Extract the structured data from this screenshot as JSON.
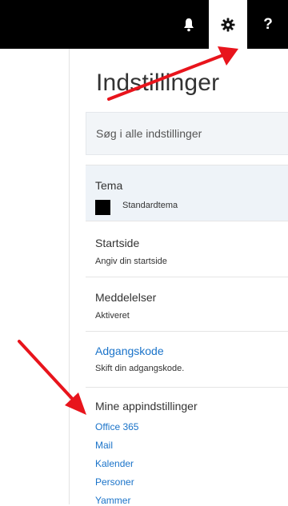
{
  "header": {
    "icons": [
      {
        "name": "bell-icon",
        "glyph": "🔔"
      },
      {
        "name": "gear-icon",
        "glyph": "⚙"
      },
      {
        "name": "help-icon",
        "glyph": "?"
      }
    ],
    "accent_color": "#000000"
  },
  "settings": {
    "title": "Indstillinger",
    "search_placeholder": "Søg i alle indstillinger"
  },
  "sections": {
    "theme": {
      "title": "Tema",
      "value": "Standardtema"
    },
    "startpage": {
      "title": "Startside",
      "subtitle": "Angiv din startside"
    },
    "notifications": {
      "title": "Meddelelser",
      "subtitle": "Aktiveret"
    },
    "password": {
      "title": "Adgangskode",
      "subtitle": "Skift din adgangskode."
    },
    "app_settings": {
      "title": "Mine appindstillinger",
      "items": [
        "Office 365",
        "Mail",
        "Kalender",
        "Personer",
        "Yammer"
      ]
    }
  },
  "colors": {
    "link": "#1a73c9",
    "annotation_arrow": "#e8141c"
  }
}
